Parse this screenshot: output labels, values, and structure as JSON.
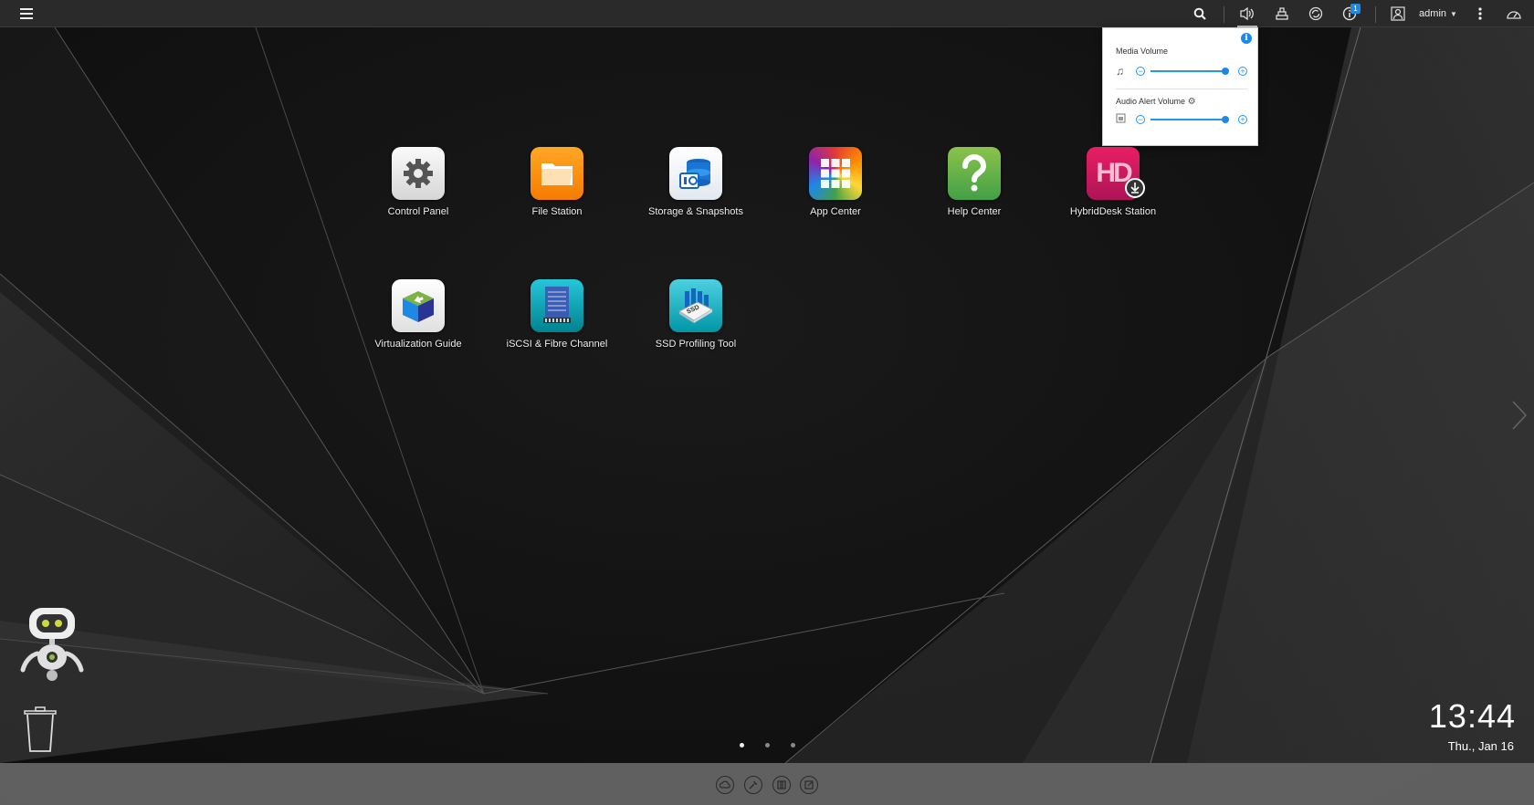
{
  "topbar": {
    "user": "admin",
    "notification_badge": "1"
  },
  "volume_popup": {
    "media_volume_label": "Media Volume",
    "media_volume_level": 1.0,
    "alert_volume_label": "Audio Alert Volume",
    "alert_volume_level": 1.0
  },
  "apps": [
    {
      "label": "Control Panel",
      "icon": "gear-icon"
    },
    {
      "label": "File Station",
      "icon": "folder-icon"
    },
    {
      "label": "Storage & Snapshots",
      "icon": "storage-icon"
    },
    {
      "label": "App Center",
      "icon": "app-grid-icon"
    },
    {
      "label": "Help Center",
      "icon": "question-icon"
    },
    {
      "label": "HybridDesk Station",
      "icon": "hd-icon"
    },
    {
      "label": "Virtualization Guide",
      "icon": "cube-icon"
    },
    {
      "label": "iSCSI & Fibre Channel",
      "icon": "server-rack-icon"
    },
    {
      "label": "SSD Profiling Tool",
      "icon": "ssd-icon"
    }
  ],
  "ssd_icon_text": "SSD",
  "hd_icon_text": "HD",
  "clock": {
    "time": "13:44",
    "date": "Thu., Jan 16"
  },
  "pages": {
    "count": 3,
    "current": 1
  },
  "colors": {
    "accent": "#1e88e5",
    "topbar": "#2a2a2a",
    "dock": "#6e6e6e"
  }
}
